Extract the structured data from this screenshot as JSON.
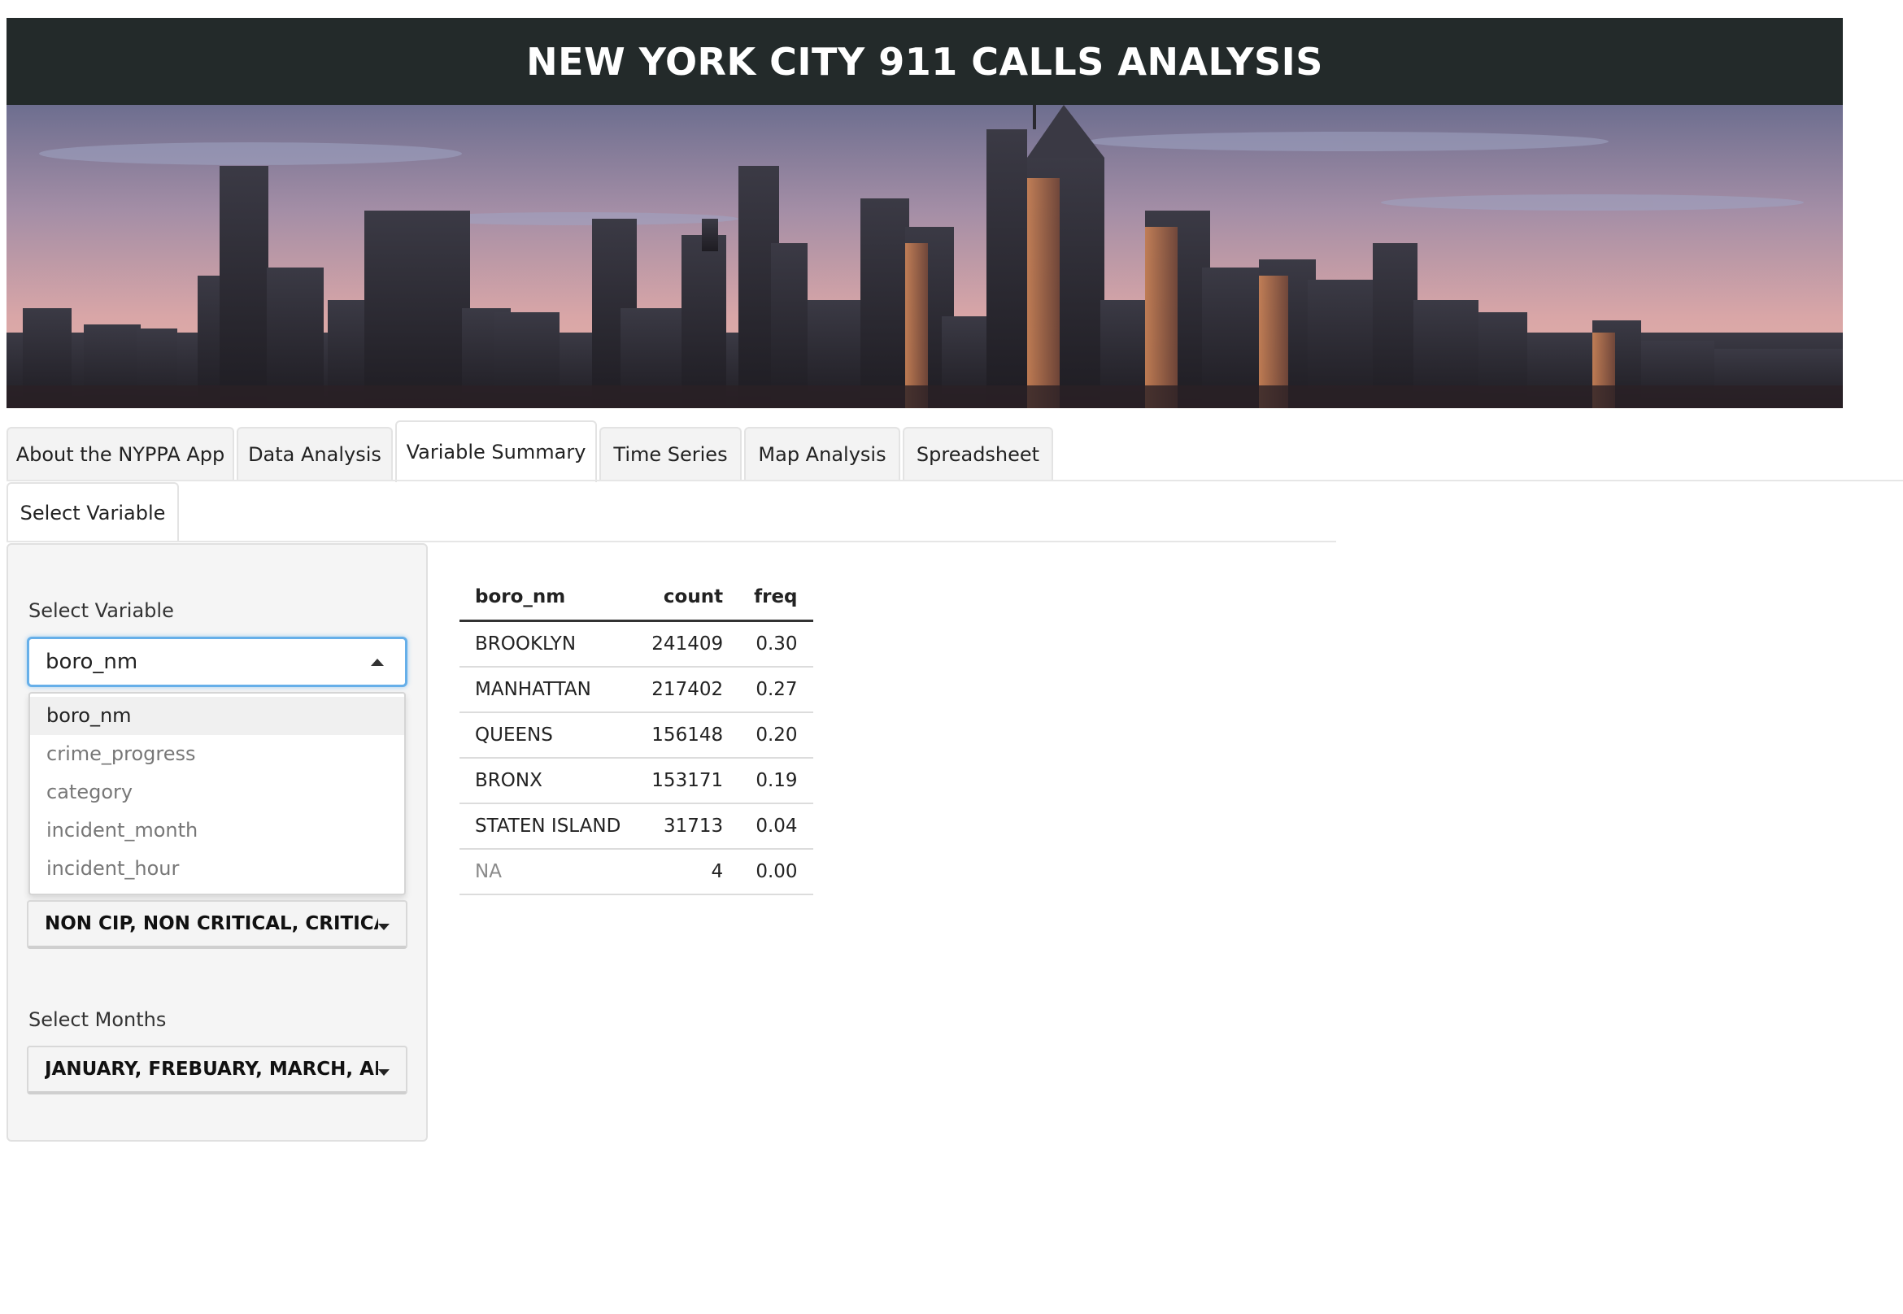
{
  "app": {
    "title": "NEW YORK CITY 911 CALLS ANALYSIS"
  },
  "tabs": [
    {
      "label": "About the NYPPA App"
    },
    {
      "label": "Data Analysis"
    },
    {
      "label": "Variable Summary",
      "active": true
    },
    {
      "label": "Time Series"
    },
    {
      "label": "Map Analysis"
    },
    {
      "label": "Spreadsheet"
    }
  ],
  "subtabs": [
    {
      "label": "Select Variable",
      "active": true
    }
  ],
  "sidebar": {
    "select_variable": {
      "label": "Select Variable",
      "value": "boro_nm",
      "options": [
        "boro_nm",
        "crime_progress",
        "category",
        "incident_month",
        "incident_hour"
      ]
    },
    "category_picker": {
      "value": "NON CIP, NON CRITICAL, CRITICAL, S"
    },
    "months_picker": {
      "label": "Select Months",
      "value": "JANUARY, FREBUARY, MARCH, APRIL"
    }
  },
  "table": {
    "headers": [
      "boro_nm",
      "count",
      "freq"
    ],
    "rows": [
      [
        "BROOKLYN",
        "241409",
        "0.30"
      ],
      [
        "MANHATTAN",
        "217402",
        "0.27"
      ],
      [
        "QUEENS",
        "156148",
        "0.20"
      ],
      [
        "BRONX",
        "153171",
        "0.19"
      ],
      [
        "STATEN ISLAND",
        "31713",
        "0.04"
      ],
      [
        "NA",
        "4",
        "0.00"
      ]
    ]
  },
  "colors": {
    "title_bar": "#232a2a",
    "focus": "#66afe9",
    "sidebar_bg": "#f5f5f5"
  }
}
